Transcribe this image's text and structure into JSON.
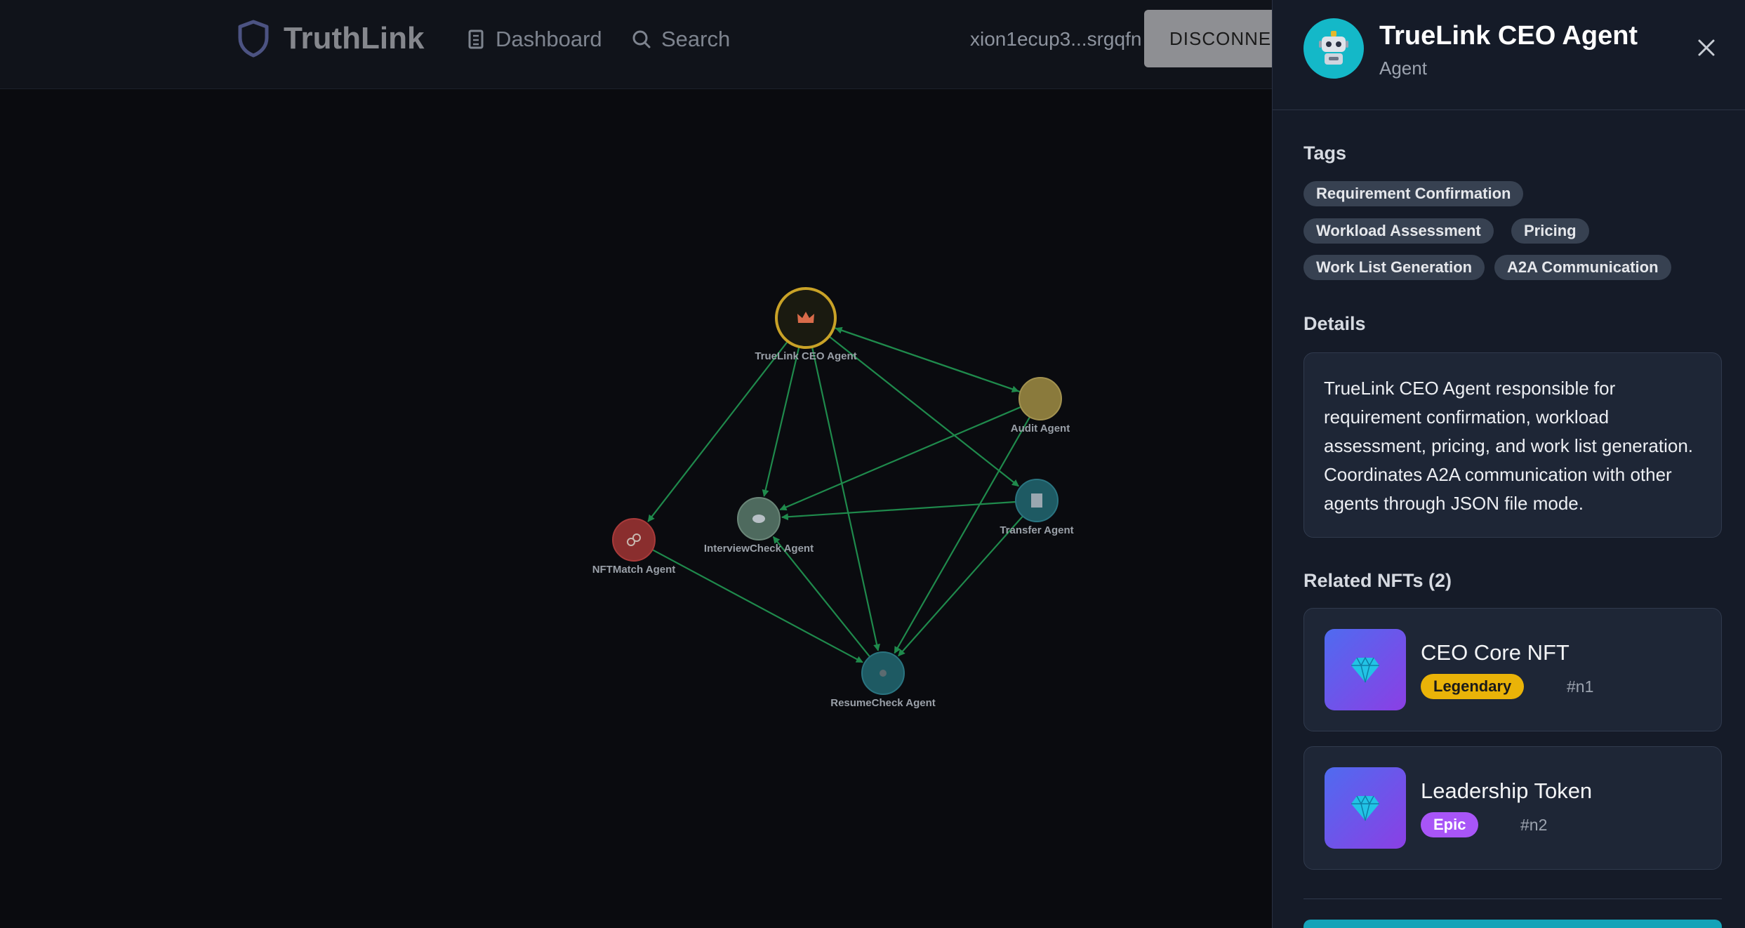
{
  "header": {
    "brand": "TruthLink",
    "nav": [
      {
        "label": "Dashboard",
        "icon": "building-icon"
      },
      {
        "label": "Search",
        "icon": "search-icon"
      }
    ],
    "wallet_address": "xion1ecup3...srgqfn",
    "disconnect_label": "DISCONNECT"
  },
  "graph": {
    "nodes": [
      {
        "label": "TrueLink CEO Agent",
        "icon": "crown",
        "fill": "#1a1a10",
        "stroke": "#c9a227"
      },
      {
        "label": "Audit Agent",
        "icon": "none",
        "fill": "#8a7a3c",
        "stroke": "#a2914f"
      },
      {
        "label": "Transfer Agent",
        "icon": "document",
        "fill": "#1e5a63",
        "stroke": "#2a7480"
      },
      {
        "label": "InterviewCheck Agent",
        "icon": "eye",
        "fill": "#4e6a5e",
        "stroke": "#6a8678"
      },
      {
        "label": "NFTMatch Agent",
        "icon": "link",
        "fill": "#8a2e2e",
        "stroke": "#a83a3a"
      },
      {
        "label": "ResumeCheck Agent",
        "icon": "magnifier",
        "fill": "#1e5a63",
        "stroke": "#2a7480"
      }
    ],
    "edge_color": "#1f8a4c"
  },
  "panel": {
    "title": "TrueLink CEO Agent",
    "subtitle": "Agent",
    "avatar_icon": "robot-icon",
    "tags_heading": "Tags",
    "tags": [
      "Requirement Confirmation",
      "Workload Assessment",
      "Pricing",
      "Work List Generation",
      "A2A Communication"
    ],
    "details_heading": "Details",
    "details_text": "TrueLink CEO Agent responsible for requirement confirmation, workload assessment, pricing, and work list generation. Coordinates A2A communication with other agents through JSON file mode.",
    "related_heading": "Related NFTs (2)",
    "nfts": [
      {
        "name": "CEO Core NFT",
        "rarity": "Legendary",
        "rarity_color": "#eab308",
        "id": "#n1"
      },
      {
        "name": "Leadership Token",
        "rarity": "Epic",
        "rarity_color": "#a855f7",
        "id": "#n2"
      }
    ]
  }
}
